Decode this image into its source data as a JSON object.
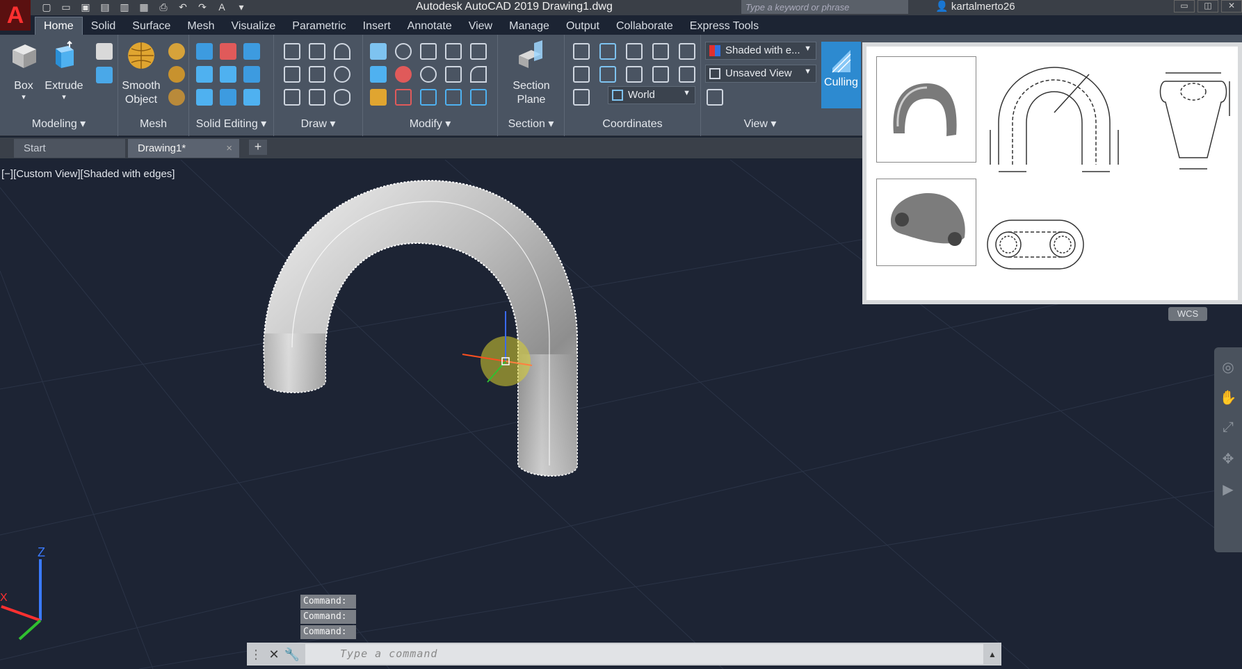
{
  "titlebar": {
    "app_letter": "A",
    "title": "Autodesk AutoCAD 2019    Drawing1.dwg",
    "search_placeholder": "Type a keyword or phrase",
    "user": "kartalmerto26"
  },
  "ribbon_tabs": [
    "Home",
    "Solid",
    "Surface",
    "Mesh",
    "Visualize",
    "Parametric",
    "Insert",
    "Annotate",
    "View",
    "Manage",
    "Output",
    "Collaborate",
    "Express Tools"
  ],
  "active_tab": "Home",
  "panels": {
    "modeling": {
      "label": "Modeling ▾",
      "box": "Box",
      "box_arrow": "▾",
      "extrude": "Extrude",
      "extrude_arrow": "▾"
    },
    "mesh": {
      "label": "Mesh",
      "smooth_1": "Smooth",
      "smooth_2": "Object"
    },
    "solid_editing": {
      "label": "Solid Editing ▾"
    },
    "draw": {
      "label": "Draw ▾"
    },
    "modify": {
      "label": "Modify ▾"
    },
    "section": {
      "label": "Section ▾",
      "plane_1": "Section",
      "plane_2": "Plane"
    },
    "coordinates": {
      "label": "Coordinates",
      "world": "World"
    },
    "view": {
      "label": "View ▾",
      "visual_style": "Shaded with e...",
      "saved_view": "Unsaved View",
      "culling": "Culling"
    }
  },
  "file_tabs": {
    "start": "Start",
    "drawing": "Drawing1*",
    "close": "×",
    "new": "+"
  },
  "viewport": {
    "label": "[−][Custom View][Shaded with edges]",
    "wcs": "WCS",
    "axis_z": "Z",
    "axis_x": "X"
  },
  "command": {
    "history": [
      "Command:",
      "Command:",
      "Command:"
    ],
    "placeholder": "Type  a  command"
  },
  "colors": {
    "ribbon": "#4a5462",
    "viewport_bg": "#1d2434",
    "accent": "#2d8ad0"
  }
}
